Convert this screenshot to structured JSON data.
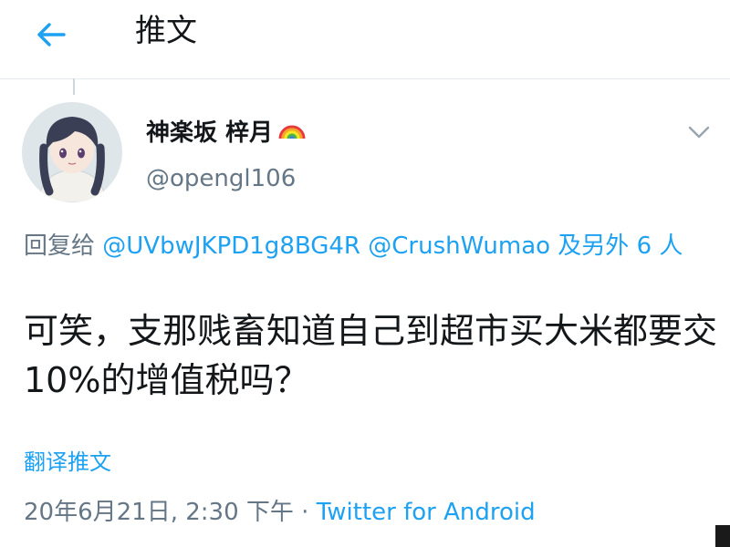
{
  "header": {
    "title": "推文",
    "back_icon": "arrow-left-icon"
  },
  "colors": {
    "accent": "#1da1f2",
    "secondary_text": "#657786",
    "primary_text": "#14171a"
  },
  "tweet": {
    "author": {
      "name": "神楽坂 梓月",
      "emoji": "🌈",
      "handle": "@opengl106"
    },
    "reply_context": {
      "prefix": "回复给 ",
      "mention_1": "@UVbwJKPD1g8BG4R",
      "mention_2": "@CrushWumao",
      "suffix": " 及另外 6 人"
    },
    "text": "可笑，支那贱畜知道自己到超市买大米都要交10%的增值税吗？",
    "translate_label": "翻译推文",
    "timestamp": "20年6月21日, 2:30 下午",
    "separator": " · ",
    "source": "Twitter for Android"
  }
}
